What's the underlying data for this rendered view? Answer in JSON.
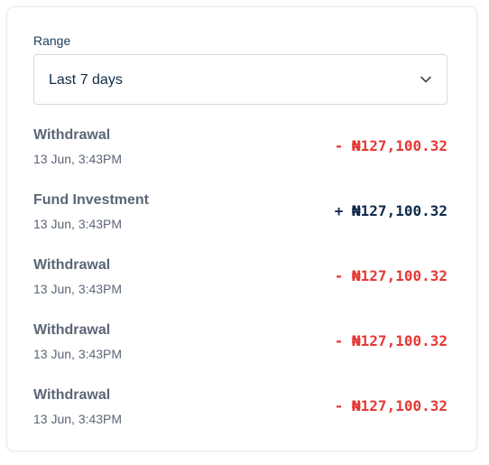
{
  "range": {
    "label": "Range",
    "selected": "Last 7 days"
  },
  "colors": {
    "debit": "#e53935",
    "credit": "#0f2a4a"
  },
  "icons": {
    "dropdown": "chevron-down-icon"
  },
  "transactions": [
    {
      "title": "Withdrawal",
      "date": "13 Jun, 3:43PM",
      "amount": "- ₦127,100.32",
      "direction": "debit"
    },
    {
      "title": "Fund Investment",
      "date": "13 Jun, 3:43PM",
      "amount": "+ ₦127,100.32",
      "direction": "credit"
    },
    {
      "title": "Withdrawal",
      "date": "13 Jun, 3:43PM",
      "amount": "- ₦127,100.32",
      "direction": "debit"
    },
    {
      "title": "Withdrawal",
      "date": "13 Jun, 3:43PM",
      "amount": "- ₦127,100.32",
      "direction": "debit"
    },
    {
      "title": "Withdrawal",
      "date": "13 Jun, 3:43PM",
      "amount": "- ₦127,100.32",
      "direction": "debit"
    }
  ]
}
